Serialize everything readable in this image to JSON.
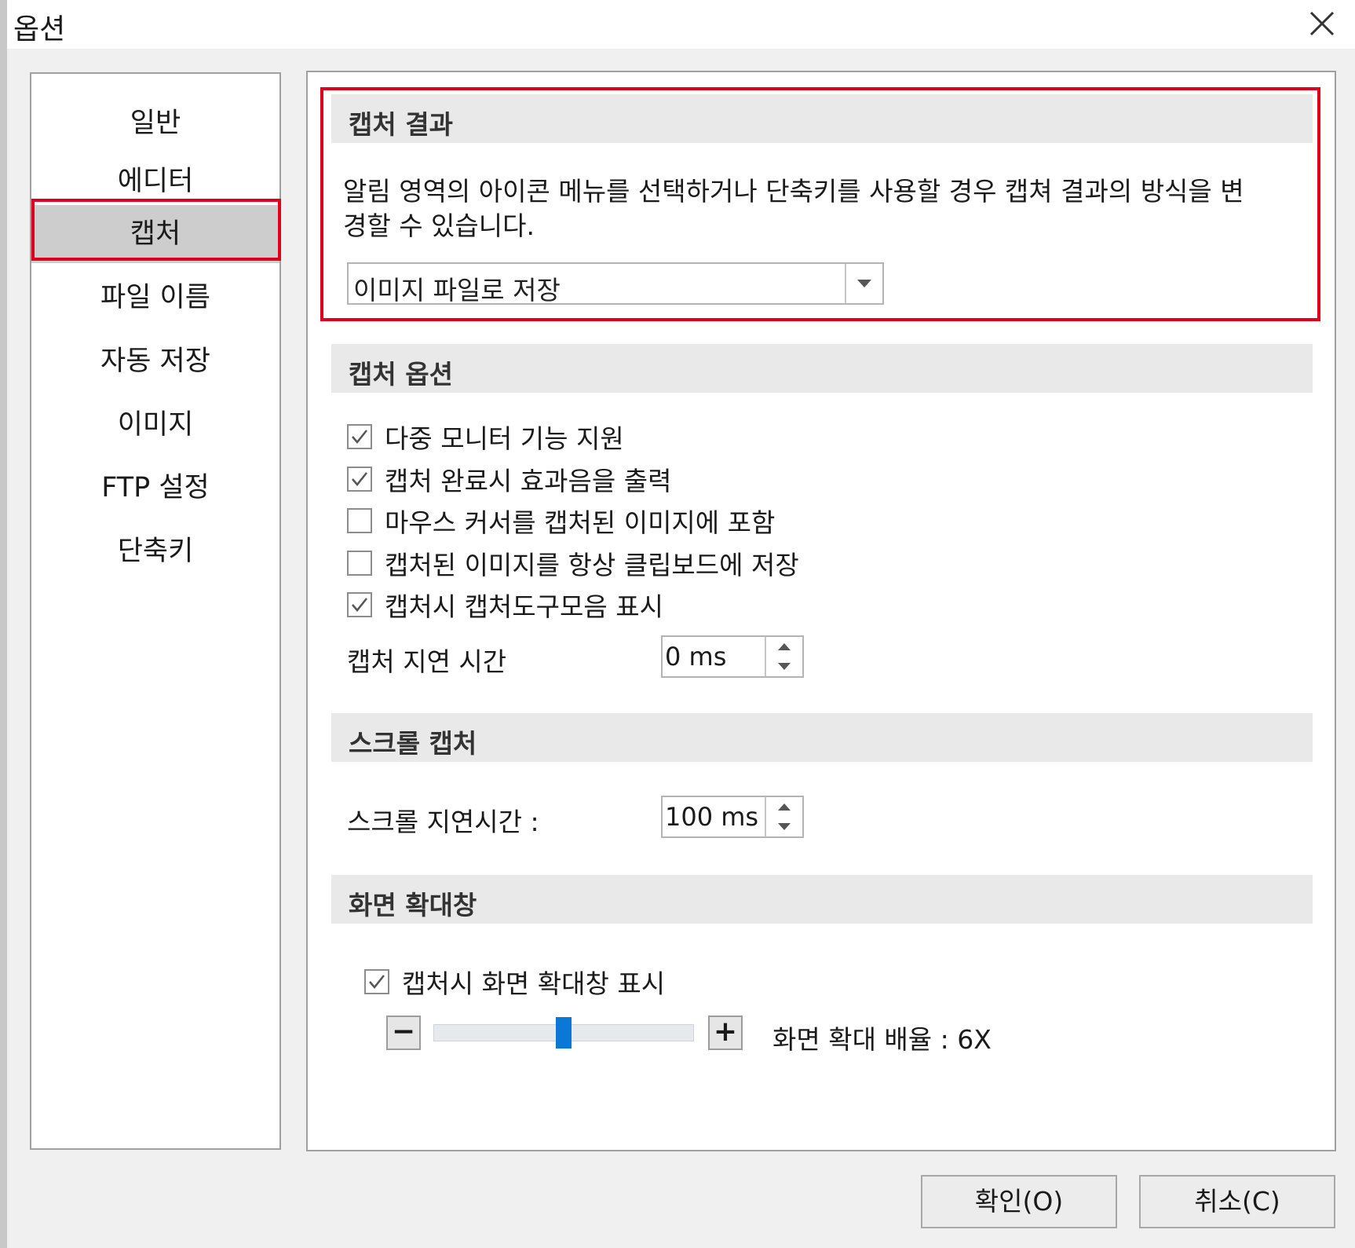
{
  "window": {
    "title": "옵션",
    "close_label": "✕"
  },
  "sidebar": {
    "items": [
      {
        "label": "일반"
      },
      {
        "label": "에디터"
      },
      {
        "label": "캡처",
        "selected": true
      },
      {
        "label": "파일 이름"
      },
      {
        "label": "자동 저장"
      },
      {
        "label": "이미지"
      },
      {
        "label": "FTP 설정"
      },
      {
        "label": "단축키"
      }
    ]
  },
  "capture_result": {
    "title": "캡처 결과",
    "description_line1": "알림 영역의 아이콘 메뉴를 선택하거나 단축키를 사용할 경우 캡쳐 결과의 방식을 변",
    "description_line2": "경할 수 있습니다.",
    "select_value": "이미지 파일로 저장"
  },
  "capture_options": {
    "title": "캡처 옵션",
    "checks": [
      {
        "label": "다중 모니터 기능 지원",
        "checked": true
      },
      {
        "label": "캡처 완료시 효과음을 출력",
        "checked": true
      },
      {
        "label": "마우스 커서를 캡처된 이미지에 포함",
        "checked": false
      },
      {
        "label": "캡처된 이미지를 항상 클립보드에 저장",
        "checked": false
      },
      {
        "label": "캡처시 캡처도구모음 표시",
        "checked": true
      }
    ],
    "delay_label": "캡처 지연 시간",
    "delay_value": "0 ms"
  },
  "scroll_capture": {
    "title": "스크롤 캡처",
    "delay_label": "스크롤 지연시간 :",
    "delay_value": "100 ms"
  },
  "magnifier": {
    "title": "화면 확대창",
    "check_label": "캡처시 화면 확대창 표시",
    "checked": true,
    "minus": "−",
    "plus": "+",
    "zoom_label": "화면 확대 배율 : 6X",
    "slider_fraction": 0.5
  },
  "buttons": {
    "ok": "확인(O)",
    "cancel": "취소(C)"
  },
  "colors": {
    "highlight": "#e0001b",
    "accent": "#0a78d7",
    "selected_bg": "#cdcdcd"
  }
}
